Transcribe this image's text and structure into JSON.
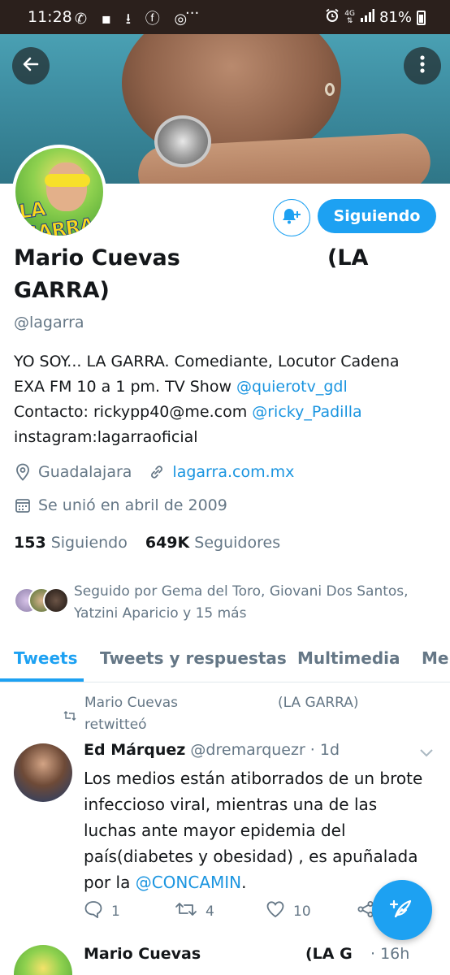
{
  "status_bar": {
    "time": "11:28",
    "icons_left": "✆ ▪ ⭳ ⓕ ◎",
    "ellipsis": "···",
    "network_top": "4G",
    "network_bottom": "⇅",
    "battery": "81%"
  },
  "profile": {
    "name_part1": "Mario Cuevas",
    "name_part2": "(LA",
    "name_part3": "GARRA)",
    "handle": "@lagarra",
    "follow_button_label": "Siguiendo",
    "avatar_logo_text": "LA GARRA",
    "bio": {
      "line1": "YO SOY... LA GARRA. Comediante, Locutor Cadena",
      "line2_text": "EXA FM 10 a 1 pm. TV Show ",
      "line2_link": "@quierotv_gdl",
      "line3_text": "Contacto: rickypp40@me.com ",
      "line3_link": "@ricky_Padilla",
      "line4": "instagram:lagarraoficial"
    },
    "location": "Guadalajara",
    "website": "lagarra.com.mx",
    "joined": "Se unió en abril de 2009",
    "following_count": "153",
    "following_label": "Siguiendo",
    "followers_count": "649K",
    "followers_label": "Seguidores",
    "followed_by_line1": "Seguido por Gema del Toro, Giovani Dos Santos,",
    "followed_by_line2": "Yatzini Aparicio y 15 más"
  },
  "tabs": [
    {
      "label": "Tweets",
      "active": true
    },
    {
      "label": "Tweets y respuestas"
    },
    {
      "label": "Multimedia"
    },
    {
      "label": "Me"
    }
  ],
  "retweet": {
    "name_part1": "Mario Cuevas",
    "name_part2": "(LA GARRA)",
    "action": "retwitteó"
  },
  "tweet": {
    "author": "Ed Márquez",
    "handle_time": "@dremarquezr · 1d",
    "line1": "Los medios están atiborrados de un brote",
    "line2": "infeccioso viral, mientras una de las",
    "line3": "luchas ante mayor epidemia del",
    "line4": "país(diabetes y obesidad) , es apuñalada",
    "line5_text": "por la ",
    "line5_link": "@CONCAMIN",
    "line5_end": ".",
    "replies": "1",
    "retweets": "4",
    "likes": "10"
  },
  "next_tweet": {
    "name_part1": "Mario Cuevas",
    "name_part2": "(LA G",
    "time": "· 16h"
  },
  "colors": {
    "accent": "#1da1f2",
    "link": "#1b95e0",
    "muted": "#657786",
    "status_bar": "#2b201c"
  }
}
